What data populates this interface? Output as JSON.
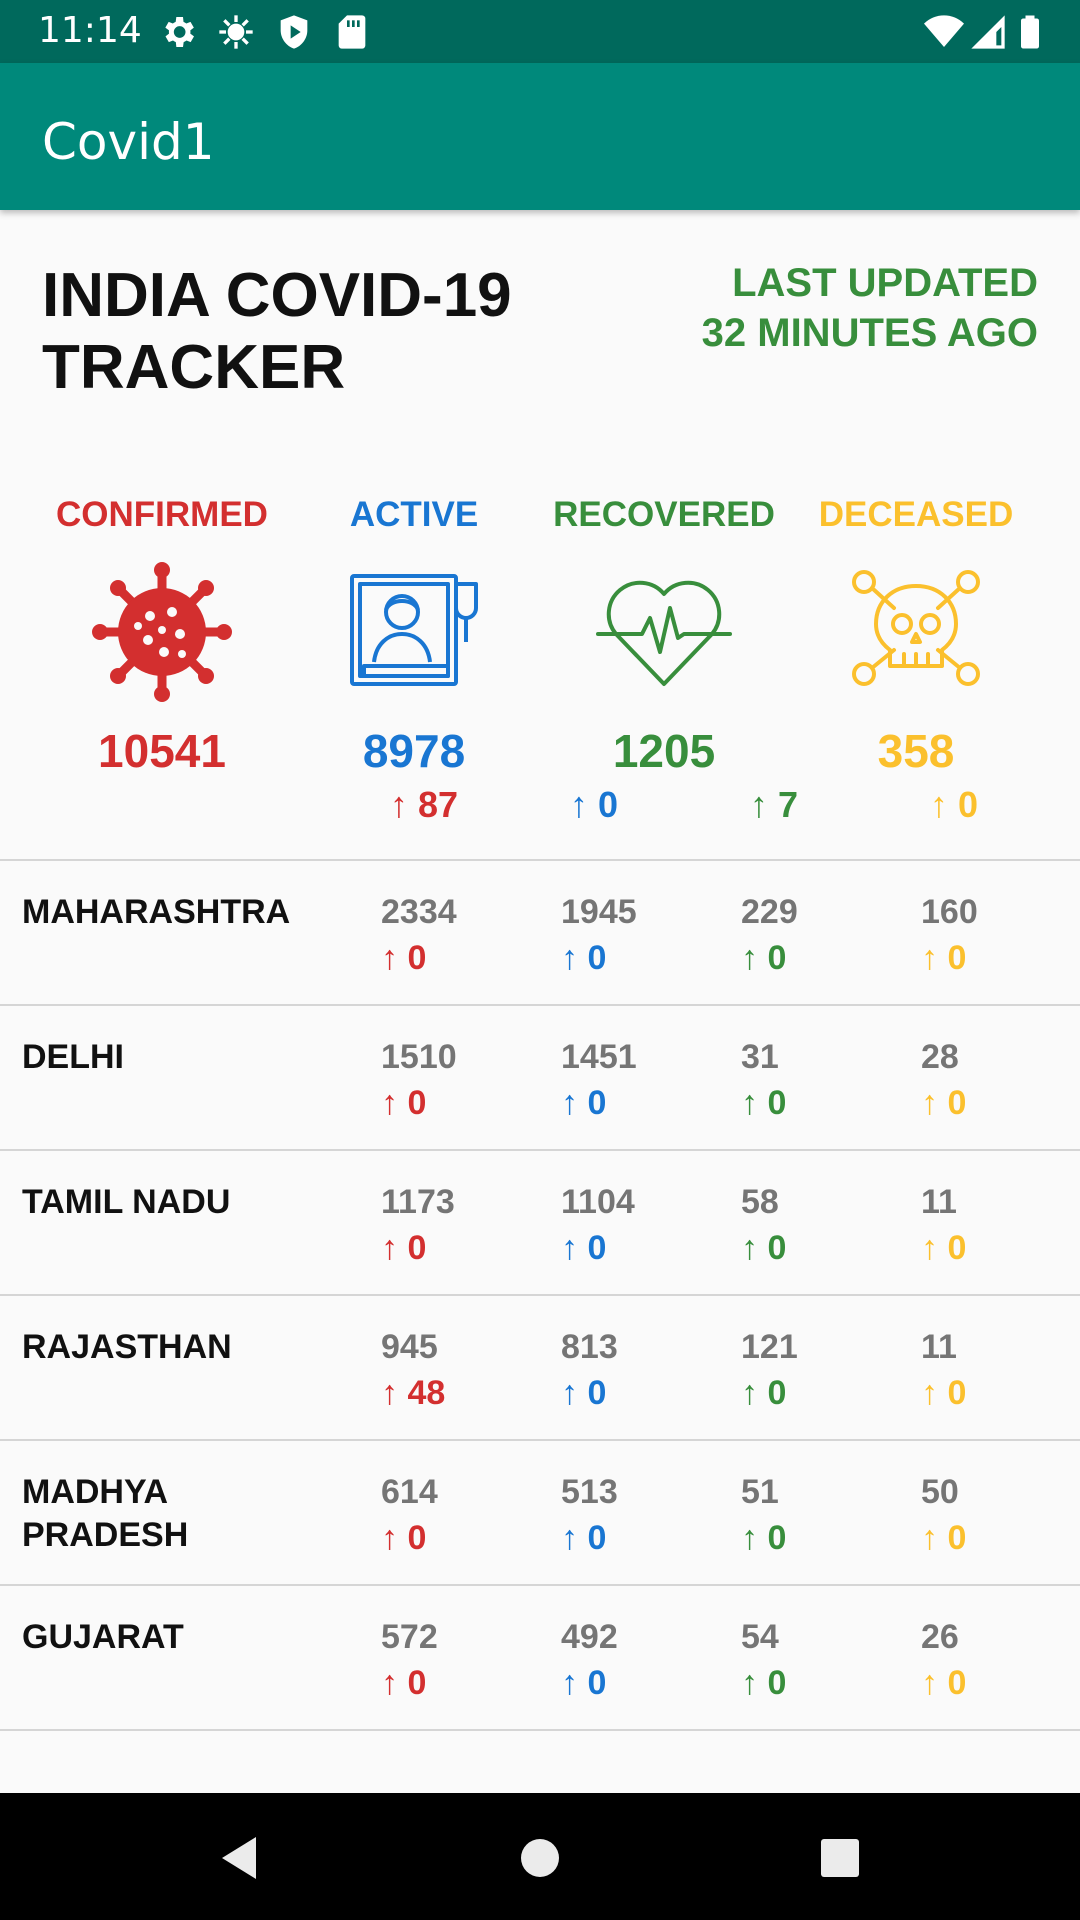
{
  "status_bar": {
    "time": "11:14"
  },
  "app_bar": {
    "title": "Covid1"
  },
  "header": {
    "title": "INDIA COVID-19 TRACKER",
    "last_updated_line1": "LAST UPDATED",
    "last_updated_line2": "32 MINUTES AGO"
  },
  "colors": {
    "confirmed": "#d32f2f",
    "active": "#1976d2",
    "recovered": "#388e3c",
    "deceased": "#fbc02d",
    "app_bar": "#00897b",
    "status_bar": "#00695c"
  },
  "summary": {
    "confirmed": {
      "label": "CONFIRMED",
      "icon": "virus-icon",
      "total": "10541",
      "delta": "↑ 87"
    },
    "active": {
      "label": "ACTIVE",
      "icon": "hospital-bed-icon",
      "total": "8978",
      "delta": "↑ 0"
    },
    "recovered": {
      "label": "RECOVERED",
      "icon": "heartbeat-icon",
      "total": "1205",
      "delta": "↑ 7"
    },
    "deceased": {
      "label": "DECEASED",
      "icon": "skull-crossbones-icon",
      "total": "358",
      "delta": "↑ 0"
    }
  },
  "states": [
    {
      "name": "MAHARASHTRA",
      "confirmed": "2334",
      "confirmed_delta": "↑ 0",
      "active": "1945",
      "active_delta": "↑ 0",
      "recovered": "229",
      "recovered_delta": "↑ 0",
      "deceased": "160",
      "deceased_delta": "↑ 0"
    },
    {
      "name": "DELHI",
      "confirmed": "1510",
      "confirmed_delta": "↑ 0",
      "active": "1451",
      "active_delta": "↑ 0",
      "recovered": "31",
      "recovered_delta": "↑ 0",
      "deceased": "28",
      "deceased_delta": "↑ 0"
    },
    {
      "name": "TAMIL NADU",
      "confirmed": "1173",
      "confirmed_delta": "↑ 0",
      "active": "1104",
      "active_delta": "↑ 0",
      "recovered": "58",
      "recovered_delta": "↑ 0",
      "deceased": "11",
      "deceased_delta": "↑ 0"
    },
    {
      "name": "RAJASTHAN",
      "confirmed": "945",
      "confirmed_delta": "↑ 48",
      "active": "813",
      "active_delta": "↑ 0",
      "recovered": "121",
      "recovered_delta": "↑ 0",
      "deceased": "11",
      "deceased_delta": "↑ 0"
    },
    {
      "name": "MADHYA PRADESH",
      "confirmed": "614",
      "confirmed_delta": "↑ 0",
      "active": "513",
      "active_delta": "↑ 0",
      "recovered": "51",
      "recovered_delta": "↑ 0",
      "deceased": "50",
      "deceased_delta": "↑ 0"
    },
    {
      "name": "GUJARAT",
      "confirmed": "572",
      "confirmed_delta": "↑ 0",
      "active": "492",
      "active_delta": "↑ 0",
      "recovered": "54",
      "recovered_delta": "↑ 0",
      "deceased": "26",
      "deceased_delta": "↑ 0"
    }
  ]
}
